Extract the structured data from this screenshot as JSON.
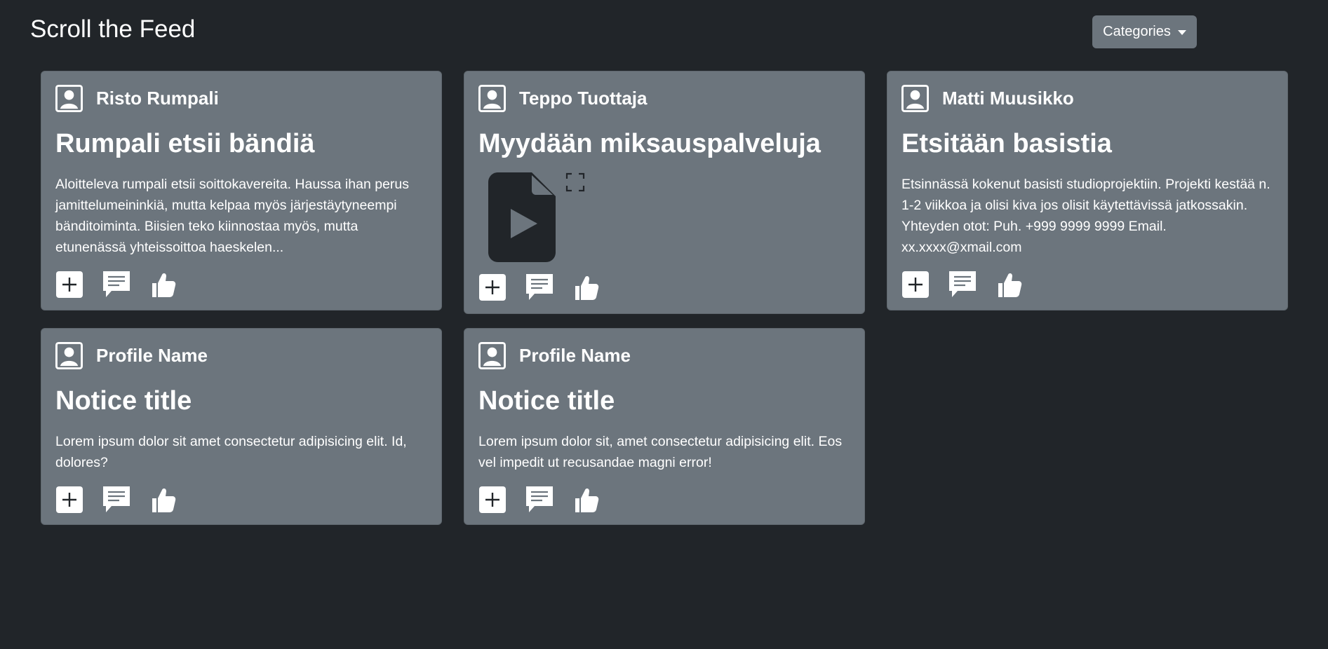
{
  "header": {
    "title": "Scroll the Feed",
    "categories_label": "Categories"
  },
  "cards": [
    {
      "profile": "Risto Rumpali",
      "title": "Rumpali etsii bändiä",
      "body": "Aloitteleva rumpali etsii soittokavereita. Haussa ihan perus jamittelumeininkiä, mutta kelpaa myös järjestäytyneempi bänditoiminta. Biisien teko kiinnostaa myös, mutta etunenässä yhteissoittoa haeskelen..."
    },
    {
      "profile": "Teppo Tuottaja",
      "title": "Myydään miksauspalveluja",
      "media": {
        "icon": "video-file-icon",
        "expand_icon": "fullscreen-icon"
      }
    },
    {
      "profile": "Matti Muusikko",
      "title": "Etsitään basistia",
      "body": "Etsinnässä kokenut basisti studioprojektiin. Projekti kestää n. 1-2 viikkoa ja olisi kiva jos olisit käytettävissä jatkossakin. Yhteyden otot: Puh. +999 9999 9999 Email. xx.xxxx@xmail.com"
    },
    {
      "profile": "Profile Name",
      "title": "Notice title",
      "body": "Lorem ipsum dolor sit amet consectetur adipisicing elit. Id, dolores?"
    },
    {
      "profile": "Profile Name",
      "title": "Notice title",
      "body": "Lorem ipsum dolor sit, amet consectetur adipisicing elit. Eos vel impedit ut recusandae magni error!"
    }
  ],
  "actions": {
    "add_icon": "plus-square-icon",
    "comment_icon": "comment-icon",
    "like_icon": "thumbs-up-icon"
  },
  "colors": {
    "background": "#212529",
    "card": "#6c757d",
    "text": "#ffffff"
  }
}
